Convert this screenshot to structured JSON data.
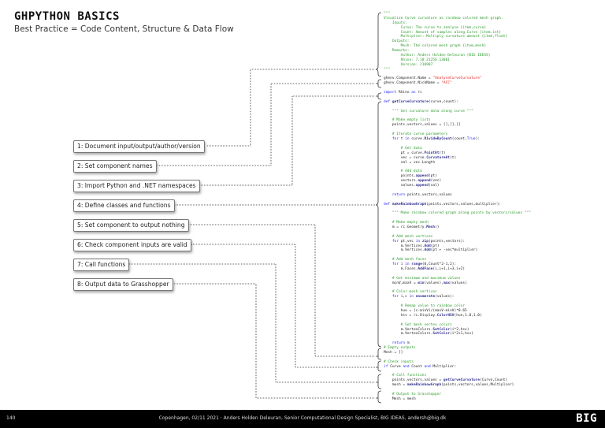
{
  "header": {
    "title": "GHPYTHON BASICS",
    "subtitle": "Best Practice = Code Content, Structure & Data Flow"
  },
  "steps": [
    "1: Document input/output/author/version",
    "2: Set component names",
    "3: Import Python and .NET namespaces",
    "4: Define classes and functions",
    "5: Set component to output nothing",
    "6: Check component inputs are valid",
    "7: Call functions",
    "8: Output data to Grasshopper"
  ],
  "code_lines": [
    "\"\"\"",
    "Visualize Curve curvature as rainbow colored mesh graph.",
    "    Inputs:",
    "        Curve: The curve to analyse {item,curve}",
    "        Count: Amount of samples along Curve {item,int}",
    "        Multiplier: Multiply curvature amount {item,float}",
    "    Outputs:",
    "        Mesh: The colored mesh graph {item,mesh}",
    "    Remarks:",
    "        Author: Anders Holden Deleuran (BIG IDEAS)",
    "        Rhino: 7.10.21256.13001",
    "        Version: 210907",
    "\"\"\"",
    "",
    "ghenv.Component.Name = \"AnalyseCurveCurvature\"",
    "ghenv.Component.NickName = \"ACC\"",
    "",
    "import Rhino as rc",
    "",
    "def getCurveCurvature(curve,count):",
    "",
    "    \"\"\" Get curvature data along curve \"\"\"",
    "",
    "    # Make empty lists",
    "    points,vectors,values = [],[],[]",
    "",
    "    # Iterate curve parameters",
    "    for t in curve.DivideByCount(count,True):",
    "",
    "        # Get data",
    "        pt = curve.PointAt(t)",
    "        vec = curve.CurvatureAt(t)",
    "        val = vec.Length",
    "",
    "        # Add data",
    "        points.append(pt)",
    "        vectors.append(vec)",
    "        values.append(val)",
    "",
    "    return points,vectors,values",
    "",
    "def makeRainbowGraph(points,vectors,values,multiplier):",
    "",
    "    \"\"\" Make rainbow colored graph along points by vectors/values \"\"\"",
    "",
    "    # Make empty mesh",
    "    m = rc.Geometry.Mesh()",
    "",
    "    # Add mesh vertices",
    "    for pt,vec in zip(points,vectors):",
    "        m.Vertices.Add(pt)",
    "        m.Vertices.Add(pt + -vec*multiplier)",
    "",
    "    # Add mesh faces",
    "    for i in range(0,Count*2-1,2):",
    "        m.Faces.AddFace(i,i+1,i+3,i+2)",
    "",
    "    # Get minimum and maximum values",
    "    minV,maxV = min(values),max(values)",
    "",
    "    # Color mesh vertices",
    "    for i,c in enumerate(values):",
    "",
    "        # Remap value to rainbow color",
    "        hue = (c-minV)/(maxV-minV)*0.65",
    "        hsv = rc.Display.ColorHSV(hue,1.0,1.0)",
    "",
    "        # Set mesh vertex colors",
    "        m.VertexColors.SetColor(i*2,hsv)",
    "        m.VertexColors.SetColor(i*2+1,hsv)",
    "",
    "    return m",
    "# Empty outputs",
    "Mesh = []",
    "",
    "# Check inputs",
    "if Curve and Count and Multiplier:",
    "",
    "    # Call functions",
    "    points,vectors,values = getCurveCurvature(Curve,Count)",
    "    mesh = makeRainbowGraph(points,vectors,values,Multiplier)",
    "",
    "    # Output to Grasshopper",
    "    Mesh = mesh"
  ],
  "footer": {
    "page_number": "140",
    "credits": "Copenhagen, 02/11 2021 · Anders Holden Deleuran, Senior Computational Design Specialist, BIG IDEAS, andersh@big.dk",
    "logo": "BIG"
  },
  "colors": {
    "comment": "#2a9a2a",
    "keyword": "#1a1aff",
    "string": "#e02020",
    "function": "#303090",
    "footer_bg": "#000000"
  }
}
